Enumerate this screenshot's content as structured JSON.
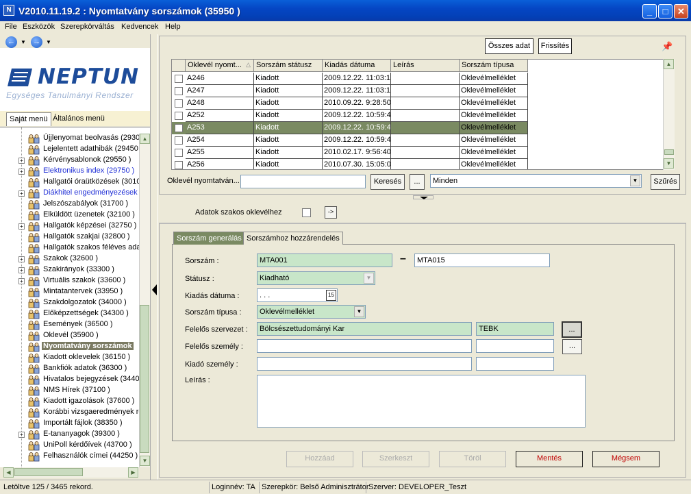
{
  "window": {
    "title": "V2010.11.19.2 : Nyomtatvány sorszámok (35950  )",
    "minimize": "_",
    "maximize": "□",
    "close": "✕"
  },
  "menu": [
    "File",
    "Eszközök",
    "Szerepkörváltás",
    "Kedvencek",
    "Help"
  ],
  "logo": {
    "name": "NEPTUN",
    "subtitle": "Egységes Tanulmányi Rendszer"
  },
  "left_tabs": [
    "Saját menü",
    "Általános menü"
  ],
  "tree": [
    {
      "label": "Újjlenyomat beolvasás (29300",
      "exp": false,
      "blue": false
    },
    {
      "label": "Lejelentett adathibák (29450",
      "exp": false,
      "blue": false
    },
    {
      "label": "Kérvénysablonok (29550  )",
      "exp": true,
      "blue": false
    },
    {
      "label": "Elektronikus index (29750  )",
      "exp": true,
      "blue": true
    },
    {
      "label": "Hallgatói óraütközések (3010",
      "exp": false,
      "blue": false
    },
    {
      "label": "Diákhitel engedményezések (",
      "exp": true,
      "blue": true
    },
    {
      "label": "Jelszószabályok (31700  )",
      "exp": false,
      "blue": false
    },
    {
      "label": "Elküldött üzenetek (32100  )",
      "exp": false,
      "blue": false
    },
    {
      "label": "Hallgatók képzései (32750  )",
      "exp": true,
      "blue": false
    },
    {
      "label": "Hallgatók szakjai (32800  )",
      "exp": false,
      "blue": false
    },
    {
      "label": "Hallgatók szakos féléves ada",
      "exp": false,
      "blue": false
    },
    {
      "label": "Szakok (32600  )",
      "exp": true,
      "blue": false
    },
    {
      "label": "Szakirányok (33300  )",
      "exp": true,
      "blue": false
    },
    {
      "label": "Virtuális szakok (33600  )",
      "exp": true,
      "blue": false
    },
    {
      "label": "Mintatantervek (33950  )",
      "exp": false,
      "blue": false
    },
    {
      "label": "Szakdolgozatok (34000  )",
      "exp": false,
      "blue": false
    },
    {
      "label": "Előképzettségek (34300  )",
      "exp": false,
      "blue": false
    },
    {
      "label": "Események (36500  )",
      "exp": false,
      "blue": false
    },
    {
      "label": "Oklevél (35900  )",
      "exp": false,
      "blue": false
    },
    {
      "label": "Nyomtatvány sorszámok",
      "exp": false,
      "blue": false,
      "selected": true
    },
    {
      "label": "Kiadott oklevelek (36150  )",
      "exp": false,
      "blue": false
    },
    {
      "label": "Bankfiók adatok (36300  )",
      "exp": false,
      "blue": false
    },
    {
      "label": "Hivatalos bejegyzések (34400",
      "exp": false,
      "blue": false
    },
    {
      "label": "NMS Hírek (37100  )",
      "exp": false,
      "blue": false
    },
    {
      "label": "Kiadott igazolások (37600  )",
      "exp": false,
      "blue": false
    },
    {
      "label": "Korábbi vizsgaeredmények rö",
      "exp": false,
      "blue": false
    },
    {
      "label": "Importált fájlok (38350  )",
      "exp": false,
      "blue": false
    },
    {
      "label": "E-tananyagok (39300  )",
      "exp": true,
      "blue": false
    },
    {
      "label": "UniPoll kérdőívek (43700  )",
      "exp": false,
      "blue": false
    },
    {
      "label": "Felhasználók címei (44250  )",
      "exp": false,
      "blue": false
    }
  ],
  "toolbar": {
    "all_data": "Összes adat",
    "refresh": "Frissítés"
  },
  "grid": {
    "headers": [
      "Oklevél nyomt...",
      "Sorszám státusz",
      "Kiadás dátuma",
      "Leírás",
      "Sorszám típusa"
    ],
    "sort_indicator": "△",
    "rows": [
      [
        "A246",
        "Kiadott",
        "2009.12.22. 11:03:1",
        "",
        "Oklevélmelléklet"
      ],
      [
        "A247",
        "Kiadott",
        "2009.12.22. 11:03:1",
        "",
        "Oklevélmelléklet"
      ],
      [
        "A248",
        "Kiadott",
        "2010.09.22. 9:28:50",
        "",
        "Oklevélmelléklet"
      ],
      [
        "A252",
        "Kiadott",
        "2009.12.22. 10:59:4",
        "",
        "Oklevélmelléklet"
      ],
      [
        "A253",
        "Kiadott",
        "2009.12.22. 10:59:4",
        "",
        "Oklevélmelléklet"
      ],
      [
        "A254",
        "Kiadott",
        "2009.12.22. 10:59:4",
        "",
        "Oklevélmelléklet"
      ],
      [
        "A255",
        "Kiadott",
        "2010.02.17. 9:56:40",
        "",
        "Oklevélmelléklet"
      ],
      [
        "A256",
        "Kiadott",
        "2010.07.30. 15:05:0",
        "",
        "Oklevélmelléklet"
      ]
    ],
    "selected_index": 4
  },
  "search": {
    "label": "Oklevél nyomtatván...",
    "value": "",
    "search_button": "Keresés",
    "more_button": "...",
    "filter_value": "Minden",
    "filter_button": "Szűrés"
  },
  "major_data": {
    "label": "Adatok szakos oklevélhez",
    "go": "->"
  },
  "form_tabs": [
    "Sorszám generálás",
    "Sorszámhoz hozzárendelés"
  ],
  "form": {
    "sorszam_label": "Sorszám :",
    "sorszam_from": "MTA001",
    "sorszam_dash": "–",
    "sorszam_to": "MTA015",
    "status_label": "Státusz :",
    "status_value": "Kiadható",
    "date_label": "Kiadás dátuma :",
    "date_value": " .  .  .",
    "calendar": "15",
    "type_label": "Sorszám típusa :",
    "type_value": "Oklevélmelléklet",
    "org_label": "Felelős szervezet :",
    "org_value": "Bölcsészettudományi Kar",
    "org_code": "TEBK",
    "person_label": "Felelős személy :",
    "person_value": "",
    "person_code": "",
    "issuer_label": "Kiadó személy :",
    "issuer_value": "",
    "issuer_code": "",
    "desc_label": "Leírás :",
    "desc_value": "",
    "ellipsis": "..."
  },
  "actions": {
    "add": "Hozzáad",
    "edit": "Szerkeszt",
    "delete": "Töröl",
    "save": "Mentés",
    "cancel": "Mégsem"
  },
  "status": {
    "loaded": "Letöltve 125 / 3465 rekord.",
    "login": "Loginnév: TA",
    "role": "Szerepkör: Belső Adminisztrátor",
    "server": "Szerver: DEVELOPER_Teszt"
  },
  "colors": {
    "selected_row": "#7a8a62",
    "green_field": "#c8e6c9",
    "title_blue": "#0546c4",
    "danger_text": "#c00000"
  }
}
